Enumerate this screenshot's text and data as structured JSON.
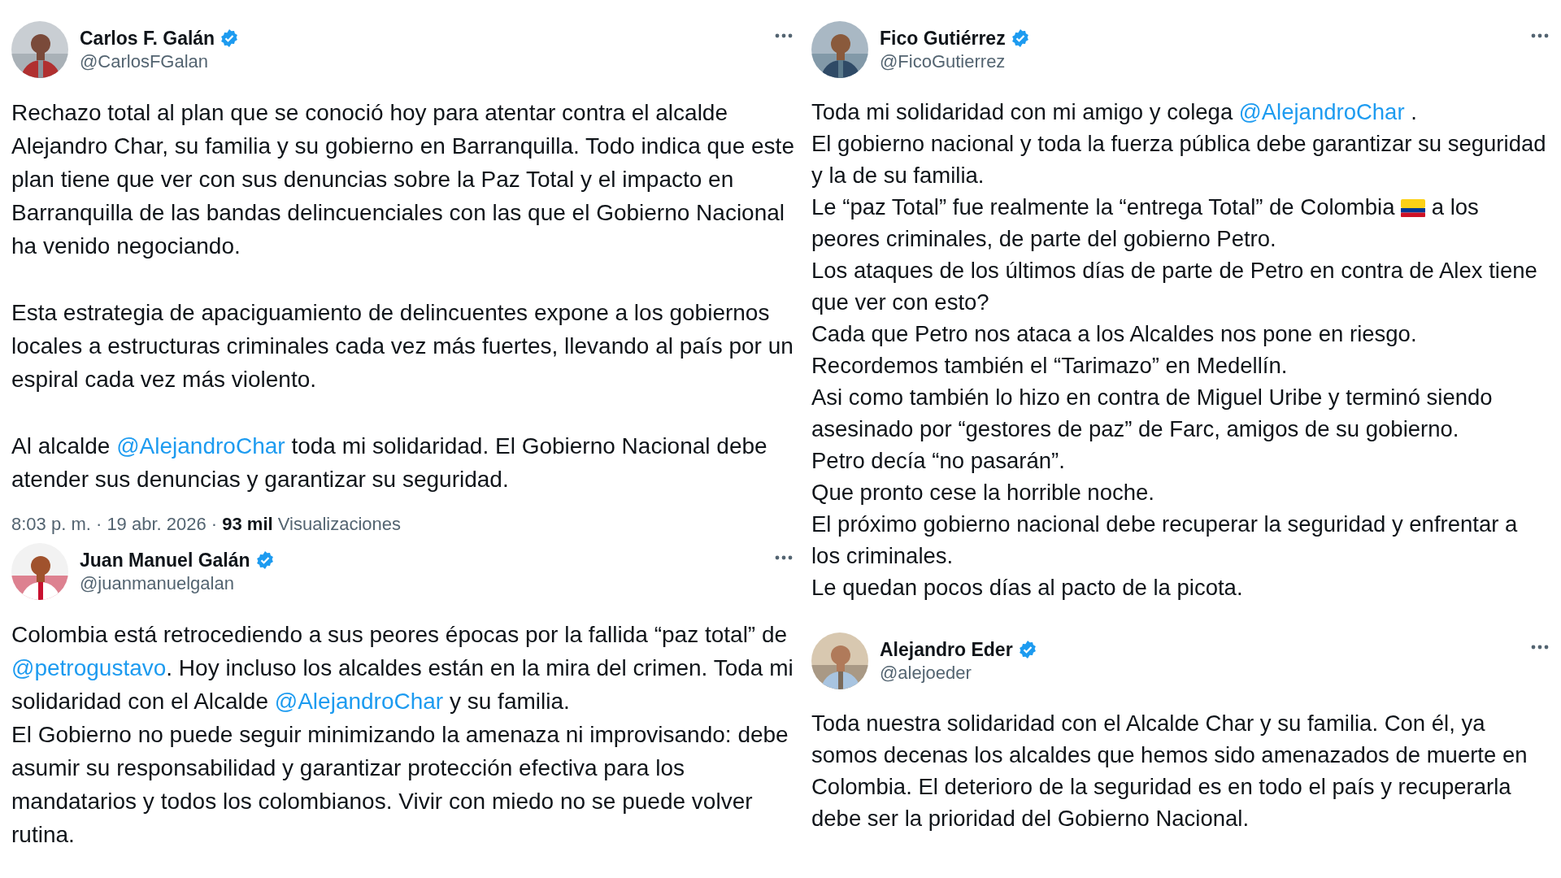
{
  "left_column": {
    "tweets": [
      {
        "name": "Carlos F. Galán",
        "verified": true,
        "handle": "@CarlosFGalan",
        "avatar": {
          "kind": "picture"
        },
        "paragraphs": [
          [
            {
              "kind": "text",
              "text": "Rechazo total al plan que se conoció hoy para atentar contra el alcalde Alejandro Char, su familia y su gobierno en Barranquilla. Todo indica que este plan tiene que ver con sus denuncias sobre la Paz Total y el impacto en Barranquilla de las bandas delincuenciales con las que el Gobierno Nacional ha venido negociando."
            }
          ],
          [
            {
              "kind": "text",
              "text": "Esta estrategia de apaciguamiento de delincuentes expone a los gobiernos locales a estructuras criminales cada vez más fuertes, llevando al país por un espiral cada vez más violento."
            }
          ],
          [
            {
              "kind": "text",
              "text": "Al alcalde "
            },
            {
              "kind": "mention",
              "text": "@AlejandroChar"
            },
            {
              "kind": "text",
              "text": " toda mi solidaridad. El Gobierno Nacional debe atender sus denuncias y garantizar su seguridad."
            }
          ]
        ],
        "meta": "8:03 p. m. · 19 abr. 2026 · **93 mil** Visualizaciones"
      },
      {
        "name": "Juan Manuel Galán",
        "verified": true,
        "handle": "@juanmanuelgalan",
        "avatar": {
          "kind": "picture"
        },
        "paragraphs": [
          [
            {
              "kind": "text",
              "text": "Colombia está retrocediendo a sus peores épocas por la fallida “paz total” de "
            },
            {
              "kind": "mention",
              "text": "@petrogustavo"
            },
            {
              "kind": "text",
              "text": ". Hoy incluso los alcaldes están en la mira del crimen. Toda mi solidaridad con el Alcalde "
            },
            {
              "kind": "mention",
              "text": "@AlejandroChar"
            },
            {
              "kind": "text",
              "text": " y su familia."
            },
            {
              "kind": "break"
            },
            {
              "kind": "text",
              "text": "El Gobierno no puede seguir minimizando la amenaza ni improvisando: debe asumir su responsabilidad y garantizar protección efectiva para los mandatarios y todos los colombianos. Vivir con miedo no se puede volver rutina."
            }
          ]
        ]
      }
    ]
  },
  "right_column": {
    "tweets": [
      {
        "name": "Fico Gutiérrez",
        "verified": true,
        "handle": "@FicoGutierrez",
        "avatar": {
          "kind": "picture"
        },
        "paragraphs": [
          [
            {
              "kind": "text",
              "text": "Toda mi solidaridad con mi amigo y colega "
            },
            {
              "kind": "mention",
              "text": "@AlejandroChar"
            },
            {
              "kind": "text",
              "text": " ."
            },
            {
              "kind": "break"
            },
            {
              "kind": "text",
              "text": "El gobierno nacional y toda la fuerza pública debe garantizar su seguridad y la de su familia."
            },
            {
              "kind": "break"
            },
            {
              "kind": "text",
              "text": "Le “paz Total” fue realmente la “entrega Total” de Colombia "
            },
            {
              "kind": "flag"
            },
            {
              "kind": "text",
              "text": " a los peores criminales, de parte del gobierno Petro."
            },
            {
              "kind": "break"
            },
            {
              "kind": "text",
              "text": "Los ataques de los últimos días de parte de Petro en contra de Alex tiene que ver con esto?"
            },
            {
              "kind": "break"
            },
            {
              "kind": "text",
              "text": "Cada que Petro nos ataca a los Alcaldes nos pone en riesgo."
            },
            {
              "kind": "break"
            },
            {
              "kind": "text",
              "text": "Recordemos también el “Tarimazo” en Medellín."
            },
            {
              "kind": "break"
            },
            {
              "kind": "text",
              "text": "Asi como también lo hizo en contra de Miguel Uribe y terminó siendo asesinado por “gestores de paz” de Farc, amigos de su gobierno."
            },
            {
              "kind": "break"
            },
            {
              "kind": "text",
              "text": "Petro decía “no pasarán”."
            },
            {
              "kind": "break"
            },
            {
              "kind": "text",
              "text": "Que pronto cese la horrible noche."
            },
            {
              "kind": "break"
            },
            {
              "kind": "text",
              "text": "El próximo gobierno nacional debe recuperar la seguridad y enfrentar a los criminales."
            },
            {
              "kind": "break"
            },
            {
              "kind": "text",
              "text": "Le quedan pocos días al pacto de la picota."
            }
          ]
        ]
      },
      {
        "name": "Alejandro Eder",
        "verified": true,
        "handle": "@alejoeder",
        "avatar": {
          "kind": "picture"
        },
        "paragraphs": [
          [
            {
              "kind": "text",
              "text": "Toda nuestra solidaridad con el Alcalde Char y su familia. Con él, ya somos decenas los alcaldes que hemos sido amenazados de muerte en Colombia. El deterioro de la seguridad es en todo el país y recuperarla debe ser la prioridad del Gobierno Nacional."
            }
          ]
        ]
      }
    ]
  }
}
